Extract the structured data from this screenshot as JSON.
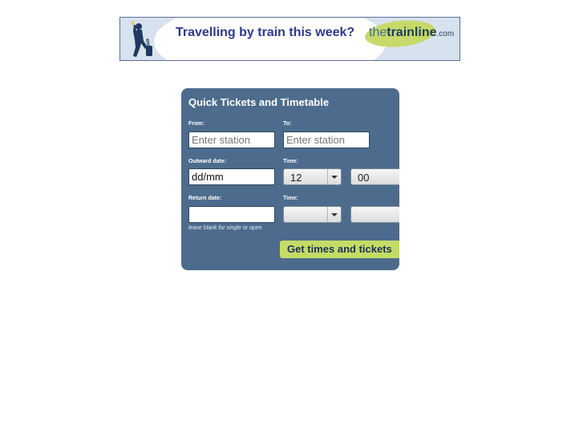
{
  "banner": {
    "headline": "Travelling by train this week?",
    "logo_the": "the",
    "logo_trainline": "trainline",
    "logo_com": ".com",
    "figure_icon": "traveller-with-suitcase-icon"
  },
  "widget": {
    "title": "Quick Tickets and Timetable",
    "from_label": "From:",
    "from_placeholder": "Enter station",
    "to_label": "To:",
    "to_placeholder": "Enter station",
    "outward_label": "Outward date:",
    "outward_value": "dd/mm",
    "outward_time_label": "Time:",
    "outward_hour": "12",
    "outward_minute": "00",
    "return_label": "Return date:",
    "return_value": "",
    "return_time_label": "Time:",
    "return_hour": "",
    "return_minute": "",
    "hint": "leave blank for single or open",
    "submit_label": "Get times and tickets"
  },
  "colors": {
    "panel": "#4d6c8d",
    "button": "#c4dc66",
    "headline": "#2c3a8c"
  }
}
